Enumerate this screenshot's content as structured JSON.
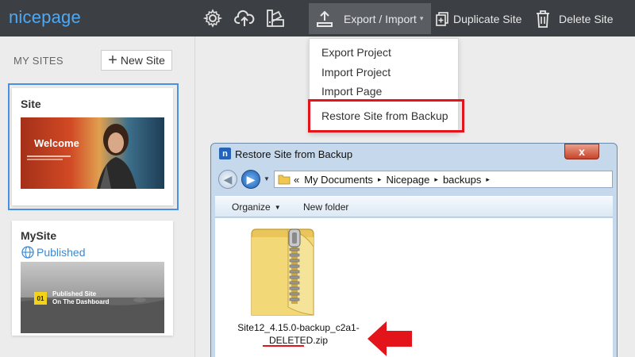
{
  "app": {
    "logo": "nicepage",
    "toolbar": {
      "export_import": "Export / Import",
      "duplicate": "Duplicate Site",
      "delete": "Delete Site"
    }
  },
  "menu": {
    "items": [
      "Export Project",
      "Import Project",
      "Import Page",
      "Restore Site from Backup"
    ]
  },
  "sidebar": {
    "heading": "MY SITES",
    "new_site": "New Site",
    "sites": [
      {
        "name": "Site",
        "thumb_text": "Welcome"
      },
      {
        "name": "MySite",
        "status": "Published",
        "thumb_badge": "01",
        "thumb_text_line1": "Published Site",
        "thumb_text_line2": "On The Dashboard"
      }
    ]
  },
  "dialog": {
    "title": "Restore Site from Backup",
    "close_label": "x",
    "breadcrumb": [
      "«",
      "My Documents",
      "▸",
      "Nicepage",
      "▸",
      "backups",
      "▸"
    ],
    "organize": "Organize",
    "new_folder": "New folder",
    "file_line1": "Site12_4.15.0-backup_c2a1-",
    "file_line2": "DELETED.zip"
  },
  "colors": {
    "accent": "#4ea9f5",
    "highlight": "#e3141a",
    "topbar": "#3c3f43"
  }
}
